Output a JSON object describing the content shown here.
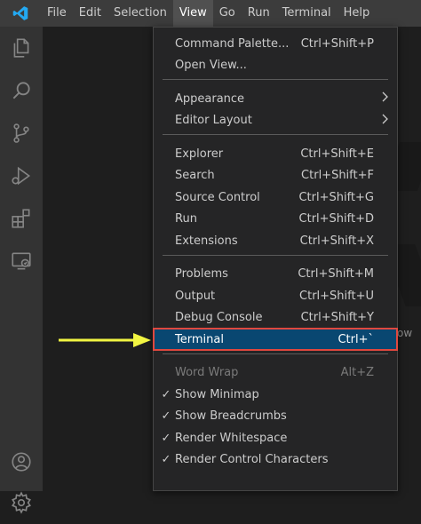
{
  "menubar": {
    "items": [
      {
        "label": "File"
      },
      {
        "label": "Edit"
      },
      {
        "label": "Selection"
      },
      {
        "label": "View",
        "active": true
      },
      {
        "label": "Go"
      },
      {
        "label": "Run"
      },
      {
        "label": "Terminal"
      },
      {
        "label": "Help"
      }
    ]
  },
  "activity_bar": {
    "icons": [
      "explorer-icon",
      "search-icon",
      "source-control-icon",
      "run-debug-icon",
      "extensions-icon",
      "remote-explorer-icon",
      "account-icon",
      "settings-gear-icon"
    ]
  },
  "view_menu": {
    "groups": [
      [
        {
          "label": "Command Palette...",
          "shortcut": "Ctrl+Shift+P"
        },
        {
          "label": "Open View...",
          "shortcut": ""
        }
      ],
      [
        {
          "label": "Appearance",
          "submenu": true
        },
        {
          "label": "Editor Layout",
          "submenu": true
        }
      ],
      [
        {
          "label": "Explorer",
          "shortcut": "Ctrl+Shift+E"
        },
        {
          "label": "Search",
          "shortcut": "Ctrl+Shift+F"
        },
        {
          "label": "Source Control",
          "shortcut": "Ctrl+Shift+G"
        },
        {
          "label": "Run",
          "shortcut": "Ctrl+Shift+D"
        },
        {
          "label": "Extensions",
          "shortcut": "Ctrl+Shift+X"
        }
      ],
      [
        {
          "label": "Problems",
          "shortcut": "Ctrl+Shift+M"
        },
        {
          "label": "Output",
          "shortcut": "Ctrl+Shift+U"
        },
        {
          "label": "Debug Console",
          "shortcut": "Ctrl+Shift+Y"
        },
        {
          "label": "Terminal",
          "shortcut": "Ctrl+`",
          "highlighted": true
        }
      ],
      [
        {
          "label": "Word Wrap",
          "shortcut": "Alt+Z",
          "disabled": true
        },
        {
          "label": "Show Minimap",
          "checked": true
        },
        {
          "label": "Show Breadcrumbs",
          "checked": true
        },
        {
          "label": "Render Whitespace",
          "checked": true
        },
        {
          "label": "Render Control Characters",
          "checked": true
        }
      ]
    ]
  },
  "editor": {
    "hint_text": "ow"
  },
  "colors": {
    "highlight_bg": "#094771",
    "highlight_border": "#e0483f",
    "arrow": "#f2f542",
    "vscode_blue": "#23a9f2"
  }
}
